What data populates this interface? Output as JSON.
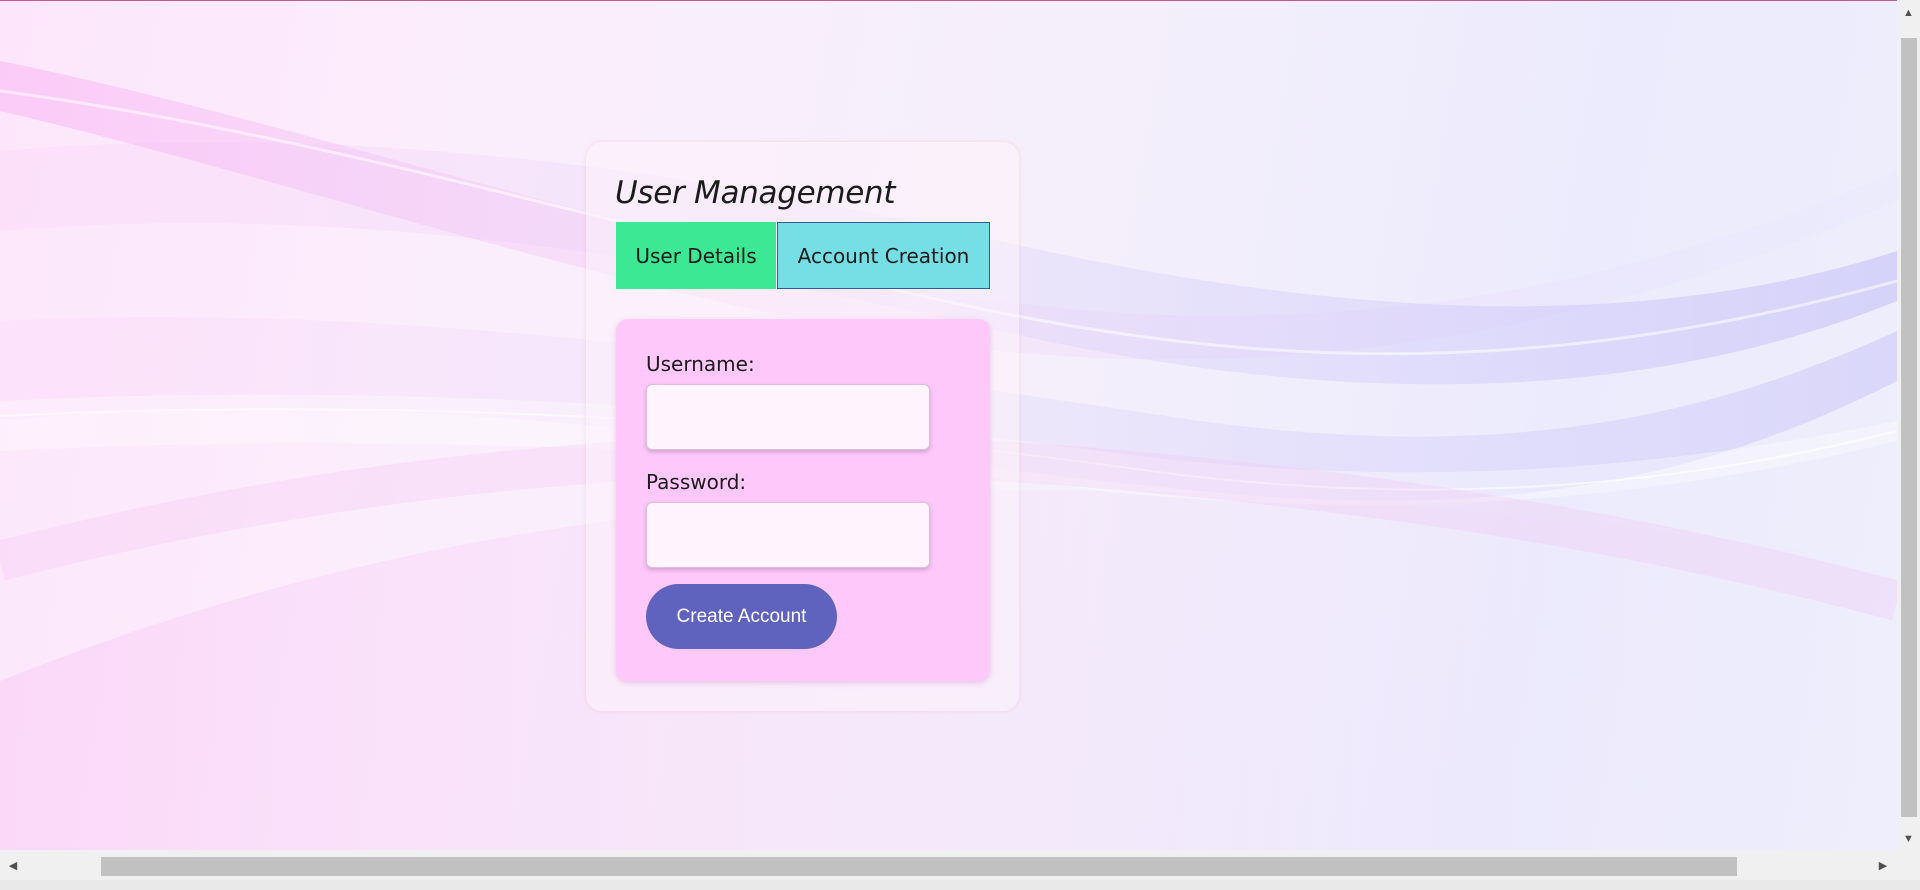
{
  "app": {
    "title": "User Management"
  },
  "tabs": [
    {
      "label": "User Details",
      "color": "#3de895"
    },
    {
      "label": "Account Creation",
      "color": "#76dfe5",
      "border_color": "#2c5e95"
    }
  ],
  "form": {
    "username_label": "Username:",
    "username_value": "",
    "password_label": "Password:",
    "password_value": "",
    "submit_label": "Create Account",
    "panel_color": "#fec8fb",
    "button_color": "#5f63bd"
  },
  "icons": {
    "scroll_up": "triangle-up",
    "scroll_down": "triangle-down",
    "scroll_left": "triangle-left",
    "scroll_right": "triangle-right"
  }
}
